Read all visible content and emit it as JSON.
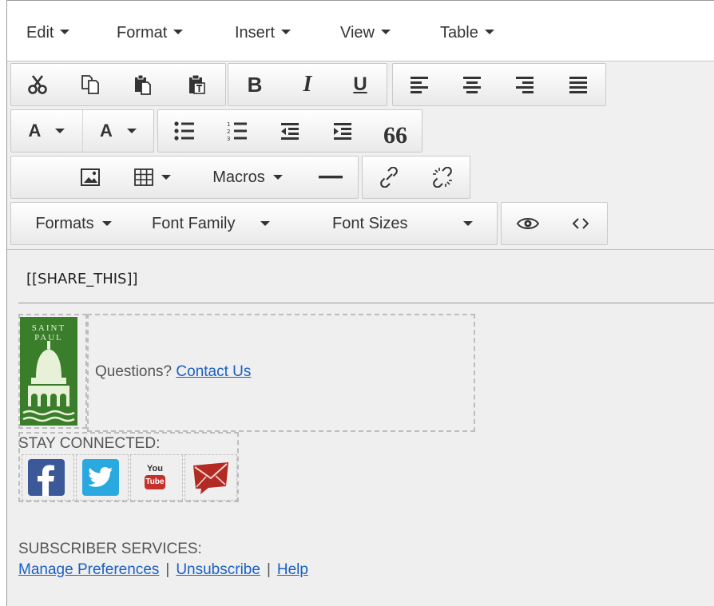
{
  "menubar": {
    "items": [
      {
        "label": "Edit"
      },
      {
        "label": "Format"
      },
      {
        "label": "Insert"
      },
      {
        "label": "View"
      },
      {
        "label": "Table"
      }
    ]
  },
  "toolbar": {
    "row1": {
      "icons": [
        "cut-icon",
        "copy-icon",
        "paste-icon",
        "paste-text-icon",
        "bold-icon",
        "italic-icon",
        "underline-icon",
        "align-left-icon",
        "align-center-icon",
        "align-right-icon",
        "align-justify-icon"
      ],
      "bold_glyph": "B",
      "italic_glyph": "I",
      "underline_glyph": "U"
    },
    "row2": {
      "text_color_glyph": "A",
      "background_color_glyph": "A",
      "quote_glyph": "66",
      "icons": [
        "text-color-icon",
        "background-color-icon",
        "bullet-list-icon",
        "numbered-list-icon",
        "outdent-icon",
        "indent-icon",
        "blockquote-icon"
      ]
    },
    "row3": {
      "macros_label": "Macros",
      "icons": [
        "image-icon",
        "table-icon",
        "horizontal-rule-icon",
        "link-icon",
        "unlink-icon"
      ]
    },
    "row4": {
      "formats_label": "Formats",
      "font_family_label": "Font Family",
      "font_sizes_label": "Font Sizes",
      "icons": [
        "preview-eye-icon",
        "source-code-icon"
      ]
    }
  },
  "content": {
    "share_this": "[[SHARE_THIS]]",
    "logo_text_line1": "SAINT",
    "logo_text_line2": "PAUL",
    "questions_text": "Questions?",
    "contact_link": "Contact Us",
    "stay_connected": "STAY CONNECTED:",
    "social_icons": [
      "facebook-icon",
      "twitter-icon",
      "youtube-icon",
      "email-icon"
    ],
    "youtube_glyph_top": "You",
    "youtube_glyph_bottom": "Tube",
    "subscriber_services": "SUBSCRIBER SERVICES:",
    "links": {
      "manage": "Manage Preferences",
      "unsubscribe": "Unsubscribe",
      "help": "Help",
      "separator": "|"
    }
  },
  "colors": {
    "logo_green": "#3a7d2a",
    "link_blue": "#1a5fc4",
    "facebook_blue": "#3b5998",
    "twitter_blue": "#2aa9e0",
    "youtube_red": "#c4302b",
    "email_red": "#b22b22"
  }
}
